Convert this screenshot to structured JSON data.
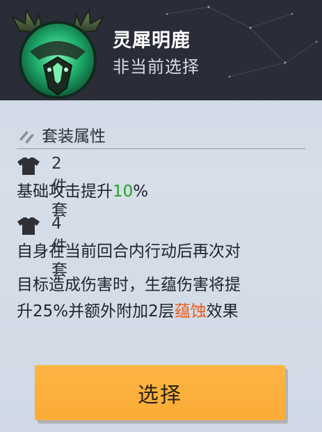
{
  "header": {
    "title": "灵犀明鹿",
    "subtitle": "非当前选择",
    "emblem_icon": "deer-antler-emblem-icon"
  },
  "set_properties": {
    "heading": "套装属性",
    "heading_icon": "double-slash-icon",
    "tiers": [
      {
        "icon": "shirt-icon",
        "label": "2件套",
        "desc_prefix": "基础攻击提升",
        "desc_value": "10",
        "desc_suffix": "%"
      },
      {
        "icon": "shirt-icon",
        "label": "4件套",
        "desc_line1": "自身在当前回合内行动后再次对",
        "desc_line2": "目标造成伤害时，生蕴伤害将提",
        "desc_line3_prefix": "升25%并额外附加2层",
        "desc_line3_highlight": "蕴蚀",
        "desc_line3_suffix": "效果"
      }
    ]
  },
  "action": {
    "select_label": "选择"
  },
  "colors": {
    "header_bg": "#2a2c38",
    "highlight_green": "#21a321",
    "highlight_orange": "#e85f1e",
    "button": "#fbab36"
  }
}
